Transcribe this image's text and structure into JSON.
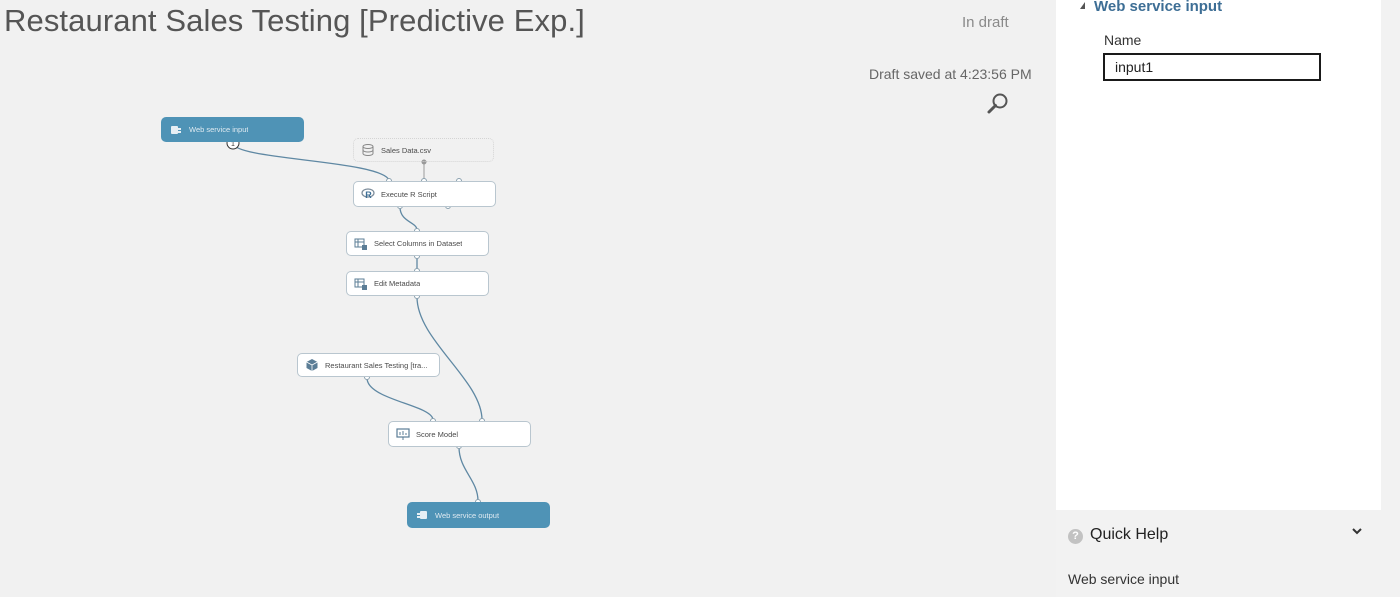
{
  "experiment": {
    "title": "Restaurant Sales Testing [Predictive Exp.]",
    "status": "In draft",
    "saved_text": "Draft saved at 4:23:56 PM"
  },
  "graph": {
    "modules": {
      "web_service_input": {
        "label": "Web service input",
        "port_badge": "1"
      },
      "sales_data": {
        "label": "Sales Data.csv"
      },
      "execute_r": {
        "label": "Execute R Script"
      },
      "select_columns": {
        "label": "Select Columns in Dataset"
      },
      "edit_metadata": {
        "label": "Edit Metadata"
      },
      "trained_model": {
        "label": "Restaurant Sales Testing [tra..."
      },
      "score_model": {
        "label": "Score Model"
      },
      "web_service_output": {
        "label": "Web service output"
      }
    }
  },
  "properties": {
    "section_title": "Web service input",
    "name_label": "Name",
    "name_value": "input1"
  },
  "quick_help": {
    "title": "Quick Help",
    "body": "Web service input"
  },
  "colors": {
    "web_service_module": "#4f93b6",
    "panel_header": "#3d6e95",
    "connector": "#5f88a3"
  }
}
